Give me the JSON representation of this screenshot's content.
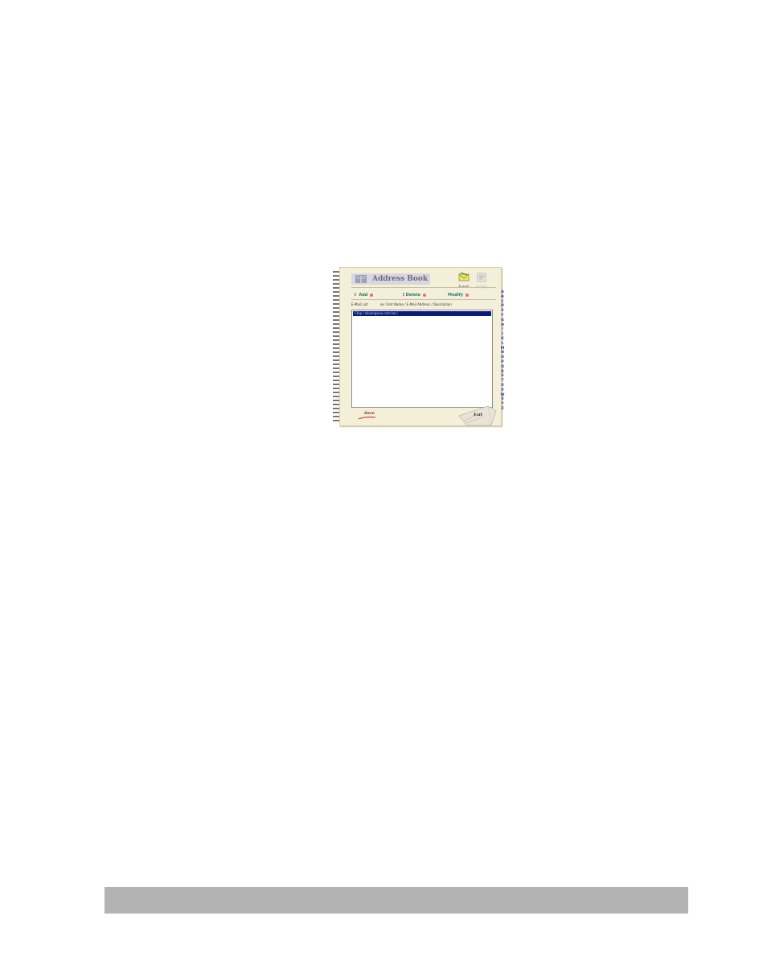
{
  "window": {
    "title": "Address Book",
    "modes": [
      {
        "label": "E-mail",
        "icon": "envelope-icon"
      },
      {
        "label": "E-copy",
        "icon": "copier-icon"
      }
    ]
  },
  "toolbar": {
    "add_label": "Add",
    "delete_label": "Delete",
    "modify_label": "Modify"
  },
  "list": {
    "title": "E-Mail List",
    "hint": "ex: First Name / E-Mail Address / Description",
    "items": [
      {
        "text": "Chip / oliver@xxx.com.tw /",
        "selected": true
      }
    ]
  },
  "alphabet": [
    "A",
    "B",
    "C",
    "D",
    "E",
    "F",
    "G",
    "H",
    "I",
    "J",
    "K",
    "L",
    "M",
    "N",
    "O",
    "P",
    "Q",
    "R",
    "S",
    "T",
    "U",
    "V",
    "W",
    "X",
    "Y",
    "Z"
  ],
  "buttons": {
    "save_label": "Save",
    "exit_label": "Exit"
  },
  "colors": {
    "page": "#f4efd9",
    "selection": "#0a1a7a",
    "action_text": "#2b7a78",
    "action_dot": "#e06c85",
    "letters": "#2a3a9a",
    "footer_bar": "#b3b3b3"
  }
}
